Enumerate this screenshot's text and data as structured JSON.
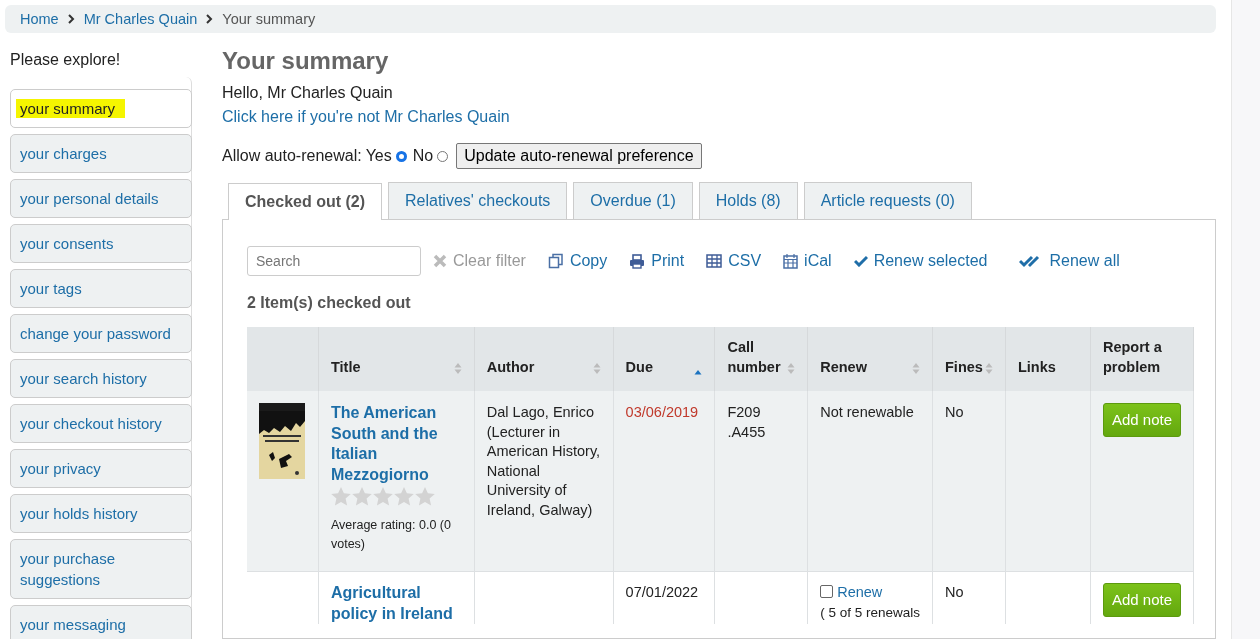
{
  "breadcrumbs": [
    {
      "label": "Home",
      "kind": "link"
    },
    {
      "label": "Mr Charles Quain",
      "kind": "link"
    },
    {
      "label": "Your summary",
      "kind": "current"
    }
  ],
  "sidebar": {
    "heading": "Please explore!",
    "items": [
      {
        "label": "your summary",
        "selected": true
      },
      {
        "label": "your charges",
        "selected": false
      },
      {
        "label": "your personal details",
        "selected": false
      },
      {
        "label": "your consents",
        "selected": false
      },
      {
        "label": "your tags",
        "selected": false
      },
      {
        "label": "change your password",
        "selected": false
      },
      {
        "label": "your search history",
        "selected": false
      },
      {
        "label": "your checkout history",
        "selected": false
      },
      {
        "label": "your privacy",
        "selected": false
      },
      {
        "label": "your holds history",
        "selected": false
      },
      {
        "label": "your purchase suggestions",
        "selected": false
      },
      {
        "label": "your messaging",
        "selected": false
      }
    ]
  },
  "title": "Your summary",
  "greeting": "Hello, Mr Charles Quain",
  "not_you_link": "Click here if you're not Mr Charles Quain",
  "auto_renewal": {
    "label": "Allow auto-renewal:",
    "options": [
      {
        "label": "Yes",
        "selected": true
      },
      {
        "label": "No",
        "selected": false
      }
    ],
    "button": "Update auto-renewal preference"
  },
  "tabs": [
    {
      "label": "Checked out (2)",
      "selected": true
    },
    {
      "label": "Relatives' checkouts",
      "selected": false
    },
    {
      "label": "Overdue (1)",
      "selected": false
    },
    {
      "label": "Holds (8)",
      "selected": false
    },
    {
      "label": "Article requests (0)",
      "selected": false
    }
  ],
  "search": {
    "placeholder": "Search"
  },
  "actions": [
    {
      "label": "Clear filter",
      "kind": "clear"
    },
    {
      "label": "Copy",
      "kind": "copy"
    },
    {
      "label": "Print",
      "kind": "print"
    },
    {
      "label": "CSV",
      "kind": "csv"
    },
    {
      "label": "iCal",
      "kind": "ical"
    },
    {
      "label": "Renew selected",
      "kind": "renew"
    },
    {
      "label": "Renew all",
      "kind": "renew-all"
    }
  ],
  "count": "2 Item(s) checked out",
  "columns": [
    {
      "label": "Title",
      "kind": "sortable"
    },
    {
      "label": "Author",
      "kind": "sortable"
    },
    {
      "label": "Due",
      "kind": "sorted"
    },
    {
      "label": "Call number",
      "kind": "sortable"
    },
    {
      "label": "Renew",
      "kind": "sortable"
    },
    {
      "label": "Fines",
      "kind": "sortable"
    },
    {
      "label": "Links",
      "kind": "plain"
    },
    {
      "label": "Report a problem",
      "kind": "plain"
    }
  ],
  "rows": [
    {
      "title": "The American South and the Italian Mezzogiorno",
      "stars": 0,
      "rating": "Average rating: 0.0 (0 votes)",
      "author": "Dal Lago, Enrico (Lecturer in American History, National University of Ireland, Galway)",
      "due": "03/06/2019",
      "overdue": true,
      "call_number": "F209 .A455",
      "renew": {
        "kind": "text",
        "text": "Not renewable"
      },
      "fines": "No",
      "button": "Add note"
    },
    {
      "title": "Agricultural policy in Ireland",
      "due": "07/01/2022",
      "overdue": false,
      "renew": {
        "kind": "checkbox",
        "checked": false,
        "link": "Renew",
        "note": "( 5 of 5 renewals"
      },
      "fines": "No",
      "button": "Add note"
    }
  ]
}
